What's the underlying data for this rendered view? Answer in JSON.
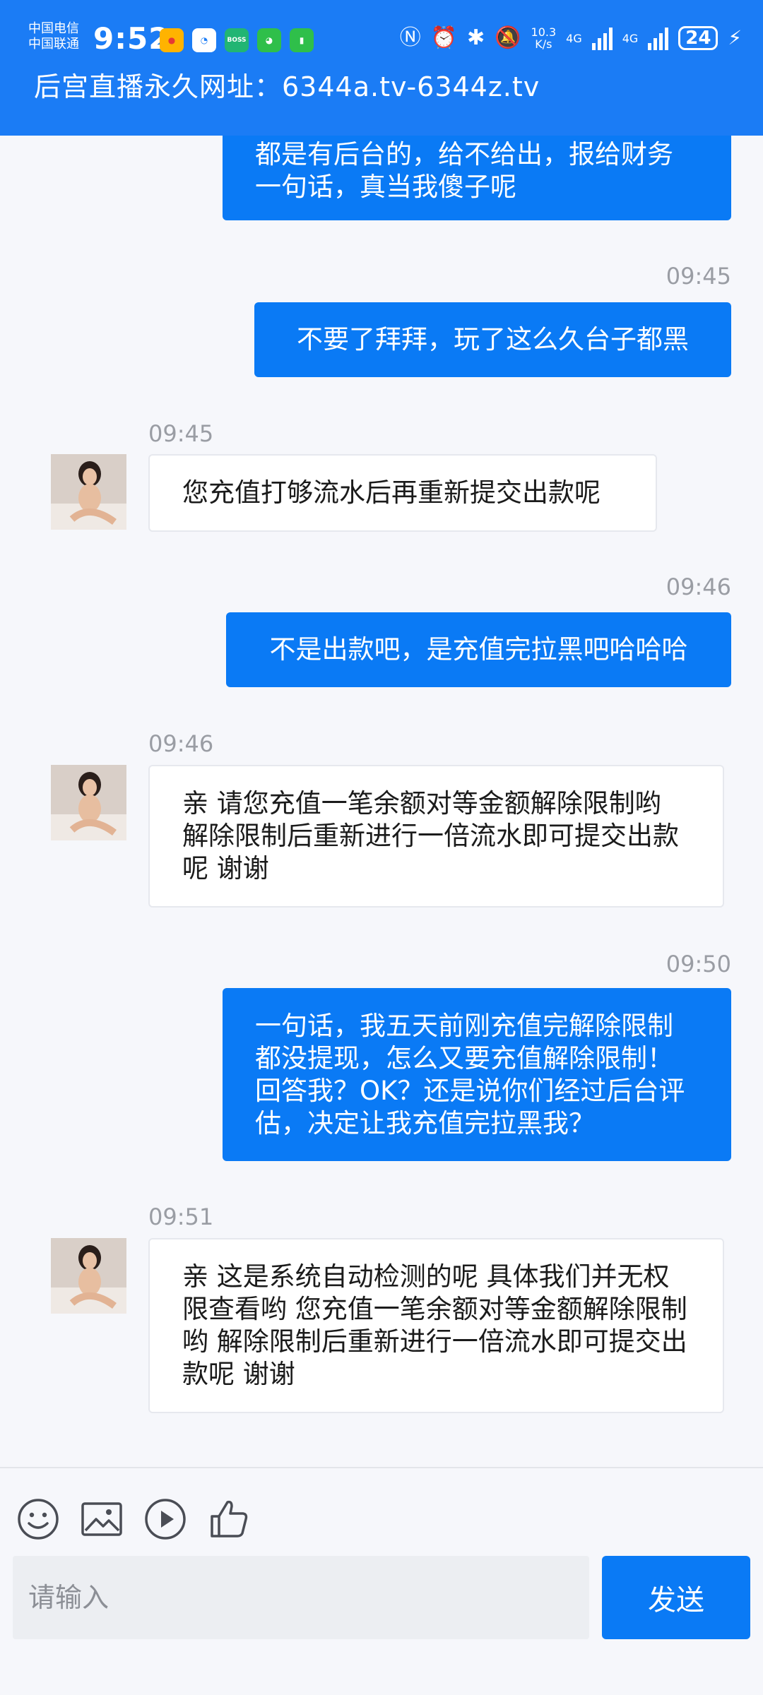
{
  "status_bar": {
    "carrier_1": "中国电信",
    "carrier_2": "中国联通",
    "time": "9:52",
    "net_speed_value": "10.3",
    "net_speed_unit": "K/s",
    "net_1": "4G",
    "net_2": "4G",
    "battery": "24",
    "app_icons": [
      "weibo",
      "message",
      "BOSS直聘",
      "wechat",
      "battery-app"
    ]
  },
  "header": {
    "title": "后宫直播永久网址：6344a.tv-6344z.tv"
  },
  "messages": [
    {
      "side": "out",
      "time": "",
      "text": "都是有后台的，给不给出，报给财务一句话，真当我傻子呢"
    },
    {
      "side": "out",
      "time": "09:45",
      "text": "不要了拜拜，玩了这么久台子都黑"
    },
    {
      "side": "in",
      "time": "09:45",
      "text": "您充值打够流水后再重新提交出款呢"
    },
    {
      "side": "out",
      "time": "09:46",
      "text": "不是出款吧，是充值完拉黑吧哈哈哈"
    },
    {
      "side": "in",
      "time": "09:46",
      "text": "亲 请您充值一笔余额对等金额解除限制哟 解除限制后重新进行一倍流水即可提交出款呢 谢谢"
    },
    {
      "side": "out",
      "time": "09:50",
      "text": "一句话，我五天前刚充值完解除限制都没提现，怎么又要充值解除限制！回答我？OK？还是说你们经过后台评估，决定让我充值完拉黑我？"
    },
    {
      "side": "in",
      "time": "09:51",
      "text": "亲 这是系统自动检测的呢 具体我们并无权限查看哟 您充值一笔余额对等金额解除限制哟 解除限制后重新进行一倍流水即可提交出款呢 谢谢"
    }
  ],
  "toolbar": {
    "icons": [
      "emoji-icon",
      "image-icon",
      "video-icon",
      "thumbs-up-icon"
    ]
  },
  "composer": {
    "placeholder": "请输入",
    "send_label": "发送"
  },
  "colors": {
    "header": "#1b7cf5",
    "bubble_out": "#0a7af5",
    "send": "#0a7af5"
  }
}
